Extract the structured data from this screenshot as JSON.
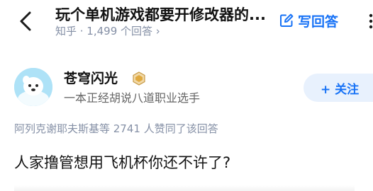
{
  "header": {
    "question_title": "玩个单机游戏都要开修改器的...",
    "question_meta": "知乎 · 1,499 个回答 ›",
    "write_answer_label": "写回答"
  },
  "author": {
    "name": "苍穹闪光",
    "bio": "一本正经胡说八道职业选手",
    "follow_label": "+ 关注"
  },
  "answer": {
    "voters_text": "阿列克谢耶夫斯基等 2741 人赞同了该回答",
    "text": "人家撸管想用飞机杯你还不许了?"
  },
  "colors": {
    "accent": "#1772f6",
    "follow_bg": "#e8f1fd",
    "meta_gray": "#8590a6",
    "avatar_bg": "#aee2f7"
  },
  "icons": {
    "back": "chevron-left-icon",
    "write": "edit-icon",
    "badge": "verified-badge-icon",
    "more": "more-icon"
  }
}
